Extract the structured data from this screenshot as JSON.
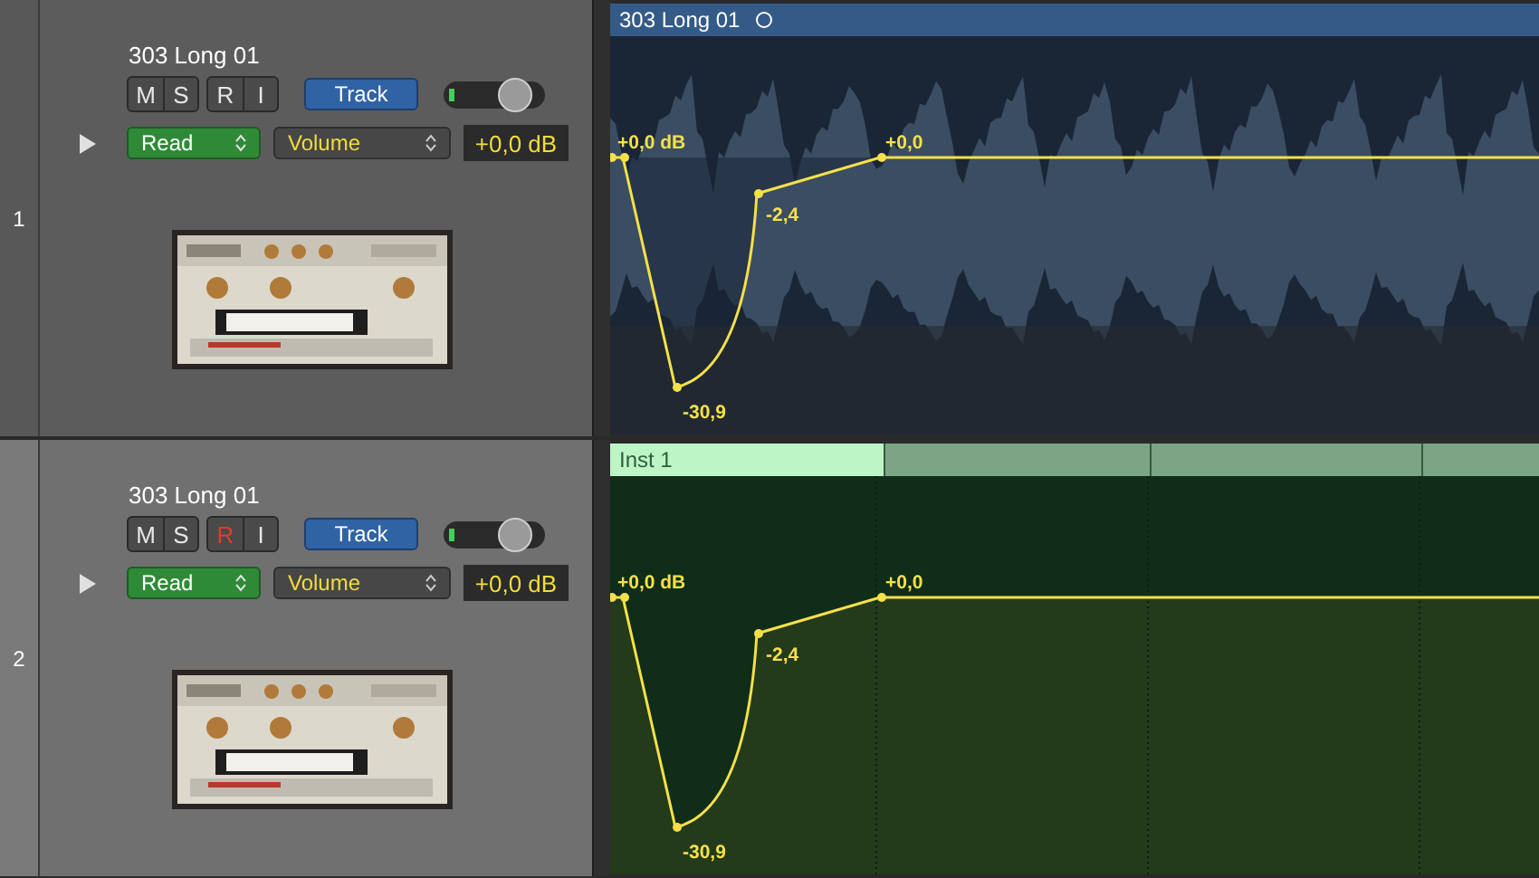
{
  "tracks": [
    {
      "number": "1",
      "selected": false,
      "name": "303 Long 01",
      "buttons": [
        {
          "kind": "mute",
          "label": "M",
          "on": false
        },
        {
          "kind": "solo",
          "label": "S",
          "on": false
        },
        {
          "kind": "record",
          "label": "R",
          "on": false
        },
        {
          "kind": "input",
          "label": "I",
          "on": false
        }
      ],
      "track_button": "Track",
      "volume": {
        "level": 0.8
      },
      "meter": {
        "level": 0.06
      },
      "disclosure": {
        "expanded": false
      },
      "automation_mode": "Read",
      "parameter": "Volume",
      "value": "+0,0 dB",
      "region": {
        "kind": "audio",
        "title": "303 Long 01",
        "automation_labels": [
          "+0,0 dB",
          "-30,9",
          "-2,4",
          "+0,0"
        ]
      }
    },
    {
      "number": "2",
      "selected": true,
      "name": "303 Long 01",
      "buttons": [
        {
          "kind": "mute",
          "label": "M",
          "on": false
        },
        {
          "kind": "solo",
          "label": "S",
          "on": false
        },
        {
          "kind": "record",
          "label": "R",
          "on": true
        },
        {
          "kind": "input",
          "label": "I",
          "on": false
        }
      ],
      "track_button": "Track",
      "volume": {
        "level": 0.8
      },
      "meter": {
        "level": 0.06
      },
      "disclosure": {
        "expanded": false
      },
      "automation_mode": "Read",
      "parameter": "Volume",
      "value": "+0,0 dB",
      "region": {
        "kind": "midi",
        "title": "Inst 1",
        "automation_labels": [
          "+0,0 dB",
          "-30,9",
          "-2,4",
          "+0,0"
        ]
      }
    }
  ]
}
